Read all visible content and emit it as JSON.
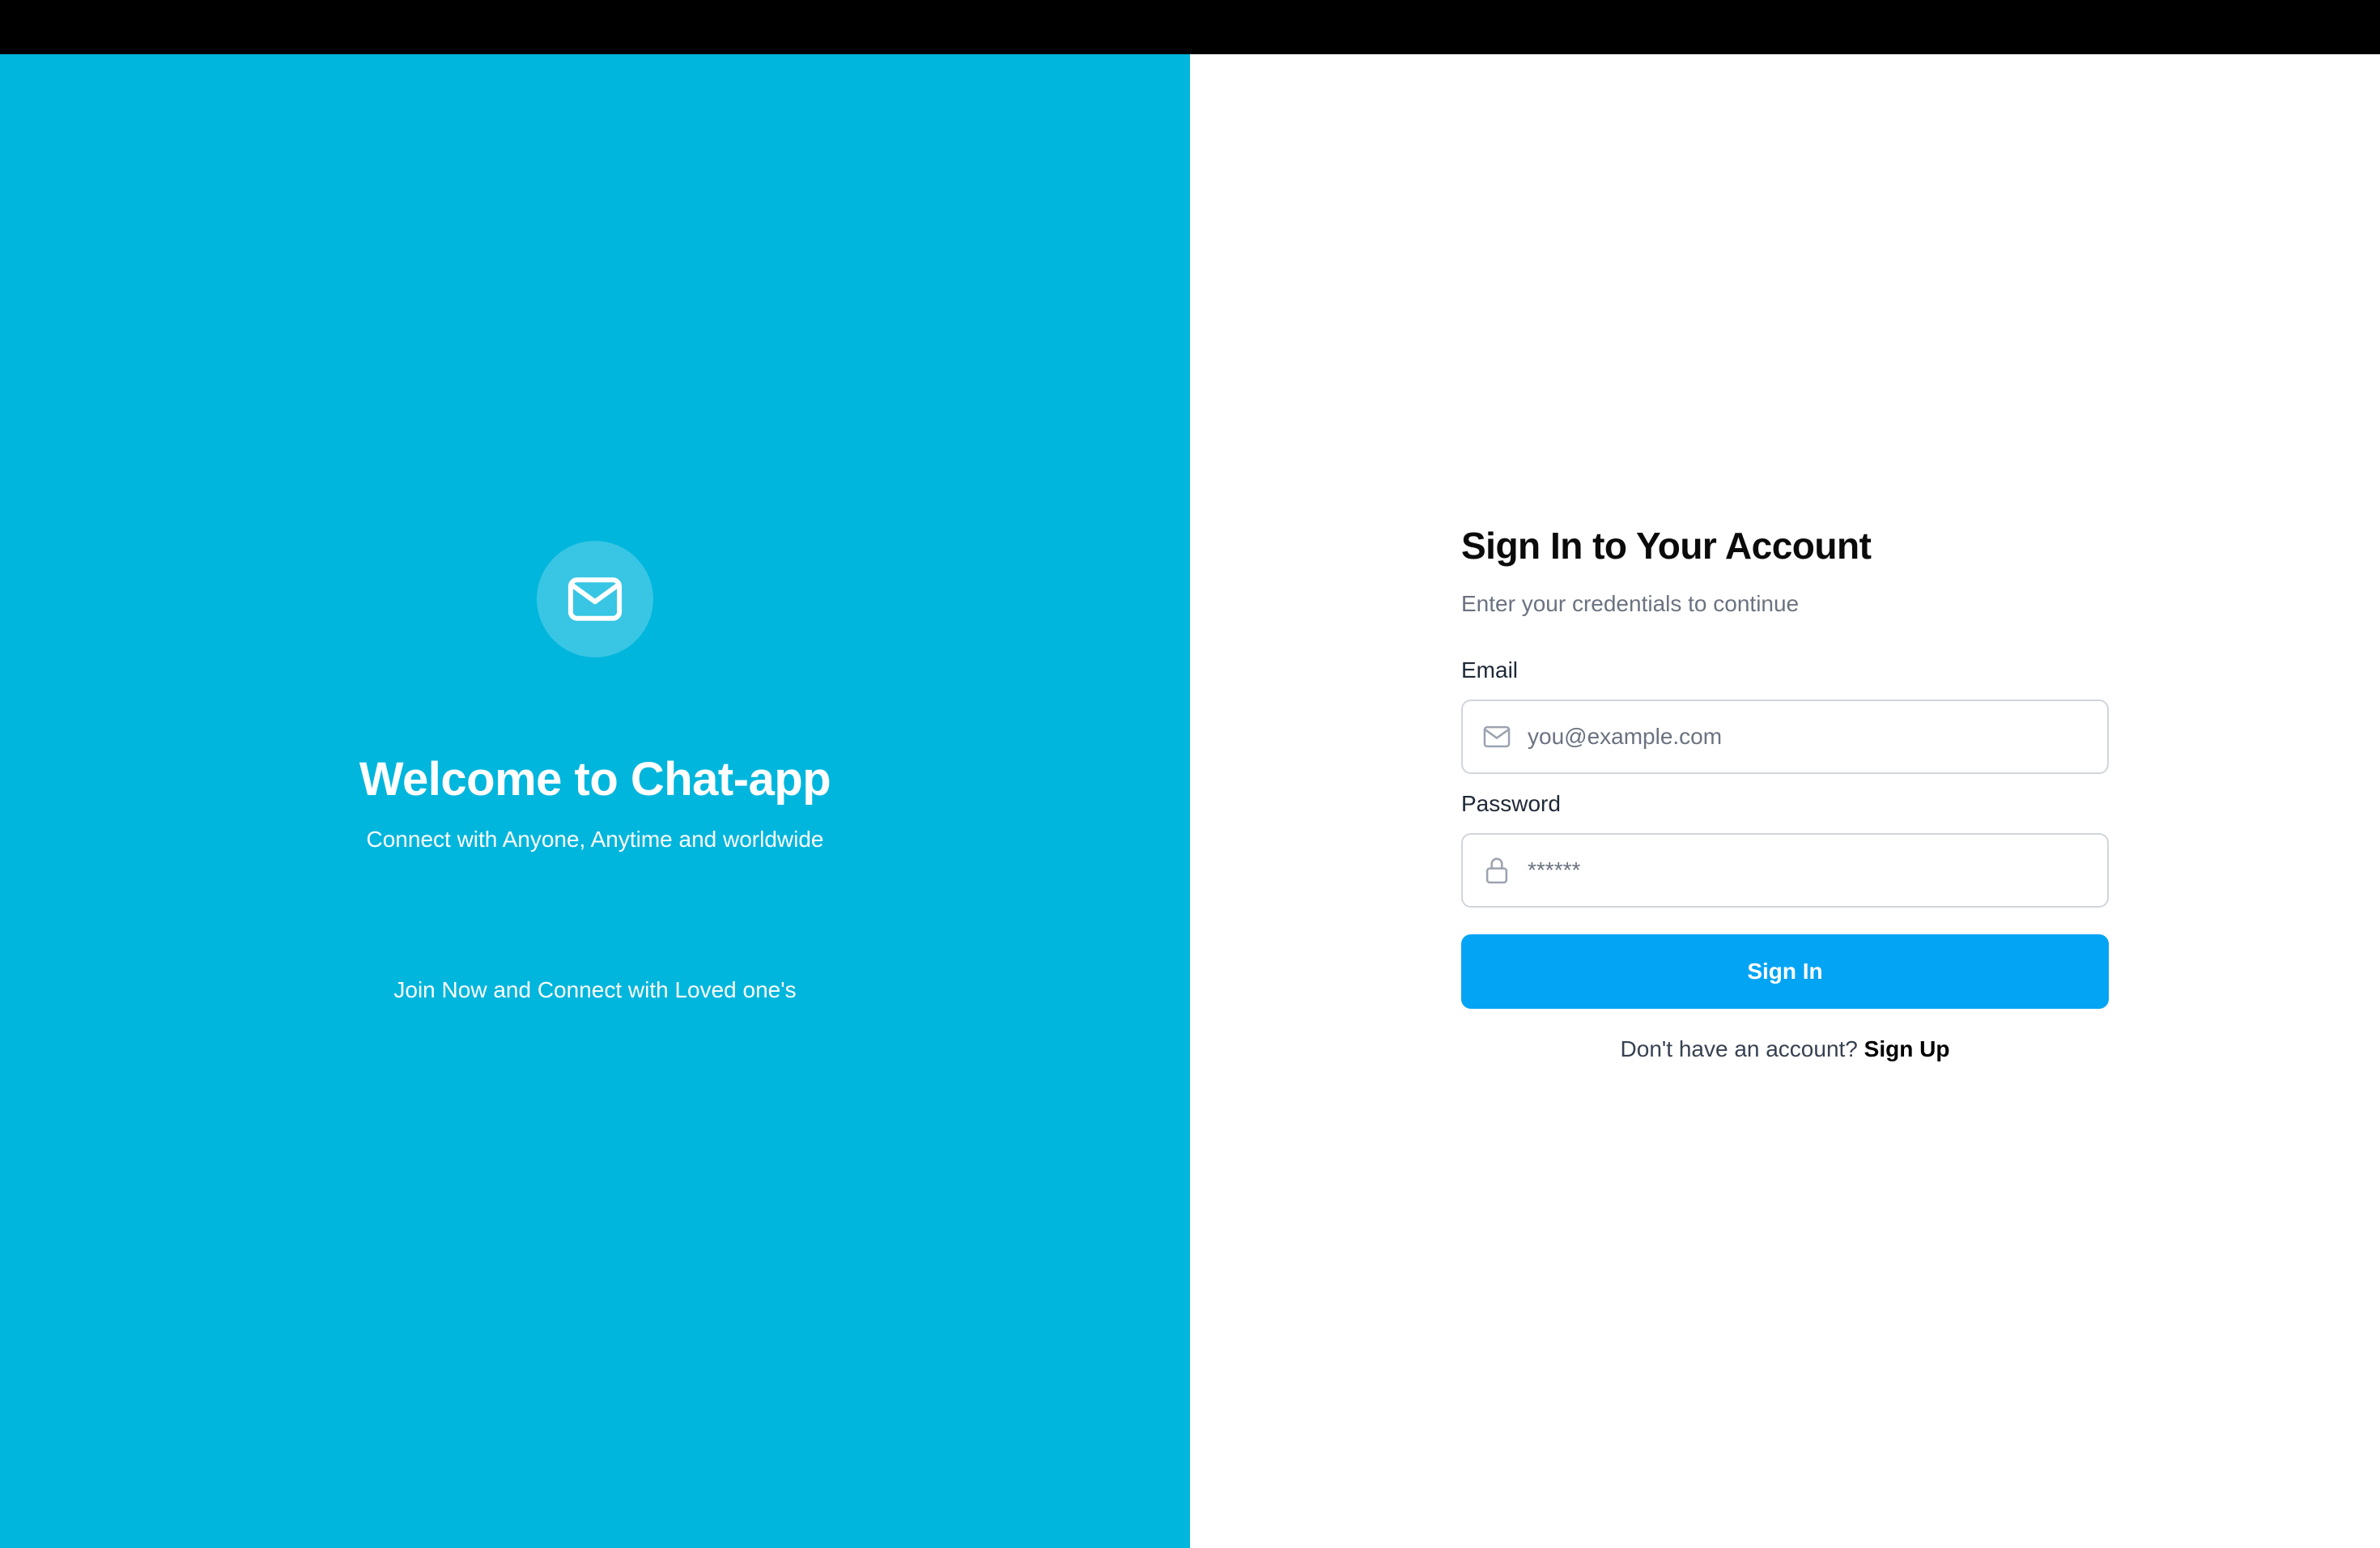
{
  "hero": {
    "logo_icon": "mail-icon",
    "title": "Welcome to Chat-app",
    "subtitle": "Connect with Anyone, Anytime and worldwide",
    "tagline": "Join Now and Connect with Loved one's",
    "background_color": "#00b6dd"
  },
  "form": {
    "title": "Sign In to Your Account",
    "subtitle": "Enter your credentials to continue",
    "email": {
      "label": "Email",
      "placeholder": "you@example.com",
      "value": "",
      "icon": "mail-icon"
    },
    "password": {
      "label": "Password",
      "placeholder": "******",
      "value": "",
      "icon": "lock-icon"
    },
    "submit_label": "Sign In",
    "signup_prompt": "Don't have an account?",
    "signup_link": "Sign Up",
    "accent_color": "#03a4f4"
  }
}
